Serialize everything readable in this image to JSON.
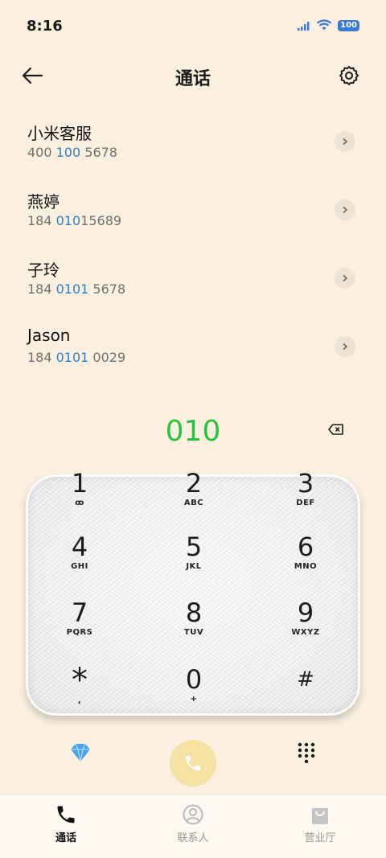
{
  "status_bar": {
    "time": "8:16",
    "battery": "100"
  },
  "header": {
    "title": "通话",
    "back_icon": "arrow-left-icon",
    "settings_icon": "gear-icon"
  },
  "results": [
    {
      "name": "小米客服",
      "number_parts": [
        "400 ",
        "100",
        " 5678"
      ]
    },
    {
      "name": "燕婷",
      "number_parts": [
        "184 ",
        "010",
        "15689"
      ]
    },
    {
      "name": "子玲",
      "number_parts": [
        "184 ",
        "0101",
        " 5678"
      ]
    },
    {
      "name": "Jason",
      "number_parts": [
        "184 ",
        "0101",
        " 0029"
      ]
    }
  ],
  "dial": {
    "number": "010",
    "number_color": "#27c43f",
    "highlight_color": "#2d7fc6"
  },
  "keypad": [
    {
      "digit": "1",
      "letters": "ꝏ"
    },
    {
      "digit": "2",
      "letters": "ABC"
    },
    {
      "digit": "3",
      "letters": "DEF"
    },
    {
      "digit": "4",
      "letters": "GHI"
    },
    {
      "digit": "5",
      "letters": "JKL"
    },
    {
      "digit": "6",
      "letters": "MNO"
    },
    {
      "digit": "7",
      "letters": "PQRS"
    },
    {
      "digit": "8",
      "letters": "TUV"
    },
    {
      "digit": "9",
      "letters": "WXYZ"
    },
    {
      "digit": "*",
      "letters": ","
    },
    {
      "digit": "0",
      "letters": "+"
    },
    {
      "digit": "#",
      "letters": ""
    }
  ],
  "actions": {
    "call_button_color": "#f6e1a4"
  },
  "bottom_nav": [
    {
      "label": "通话",
      "icon": "phone-icon",
      "active": true
    },
    {
      "label": "联系人",
      "icon": "contact-icon",
      "active": false
    },
    {
      "label": "营业厅",
      "icon": "shopping-bag-icon",
      "active": false
    }
  ]
}
